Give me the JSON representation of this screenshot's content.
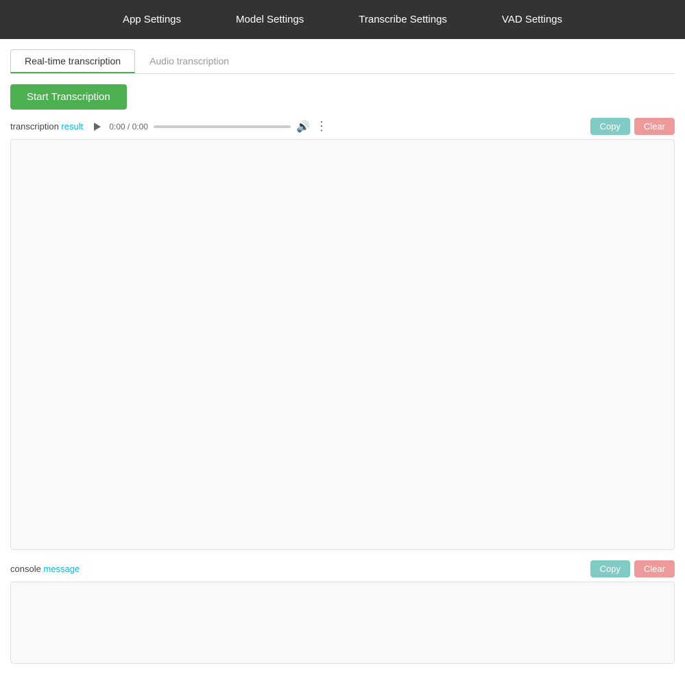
{
  "navbar": {
    "items": [
      {
        "label": "App Settings",
        "id": "app-settings"
      },
      {
        "label": "Model Settings",
        "id": "model-settings"
      },
      {
        "label": "Transcribe Settings",
        "id": "transcribe-settings"
      },
      {
        "label": "VAD Settings",
        "id": "vad-settings"
      }
    ]
  },
  "tabs": [
    {
      "label": "Real-time transcription",
      "id": "realtime",
      "active": true
    },
    {
      "label": "Audio transcription",
      "id": "audio",
      "active": false
    }
  ],
  "main": {
    "start_button_label": "Start Transcription",
    "transcription_label_part1": "transcription",
    "transcription_label_part2": " result",
    "audio_time": "0:00 / 0:00",
    "copy_button_label_1": "Copy",
    "clear_button_label_1": "Clear",
    "copy_button_label_2": "Copy",
    "clear_button_label_2": "Clear",
    "console_label_part1": "console",
    "console_label_part2": " message"
  }
}
